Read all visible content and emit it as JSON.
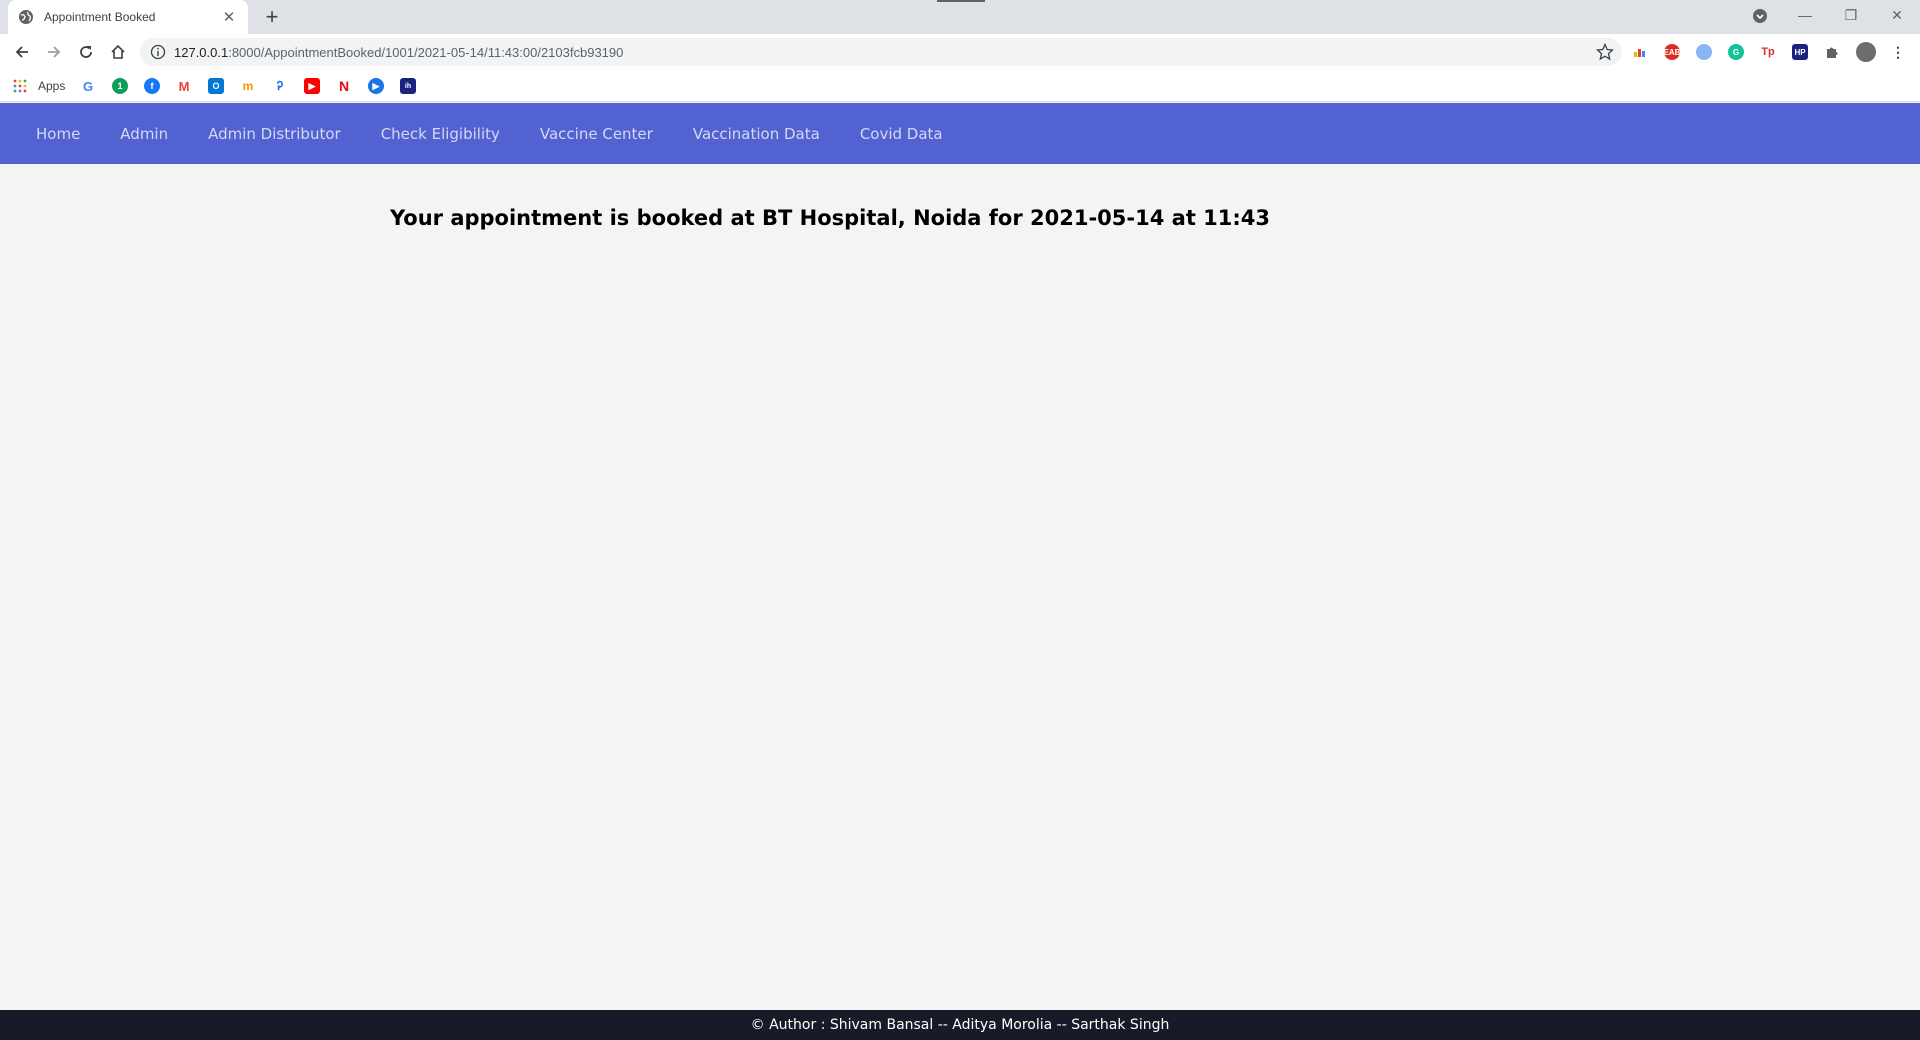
{
  "browser": {
    "tab_title": "Appointment Booked",
    "new_tab_symbol": "+",
    "close_tab_symbol": "✕",
    "url_host": "127.0.0.1",
    "url_path": ":8000/AppointmentBooked/1001/2021-05-14/11:43:00/2103fcb93190",
    "window_controls": {
      "minimize": "—",
      "restore": "❐",
      "close": "✕"
    },
    "bookmarks": {
      "apps_label": "Apps"
    }
  },
  "navbar": {
    "links": [
      "Home",
      "Admin",
      "Admin Distributor",
      "Check Eligibility",
      "Vaccine Center",
      "Vaccination Data",
      "Covid Data"
    ]
  },
  "main": {
    "message": "Your appointment is booked at BT Hospital, Noida for 2021-05-14 at 11:43"
  },
  "footer": {
    "text": "© Author : Shivam Bansal -- Aditya Morolia -- Sarthak Singh"
  },
  "colors": {
    "navbar_bg": "#5262d1",
    "page_bg": "#f4f4f4",
    "footer_bg": "#171b27"
  }
}
